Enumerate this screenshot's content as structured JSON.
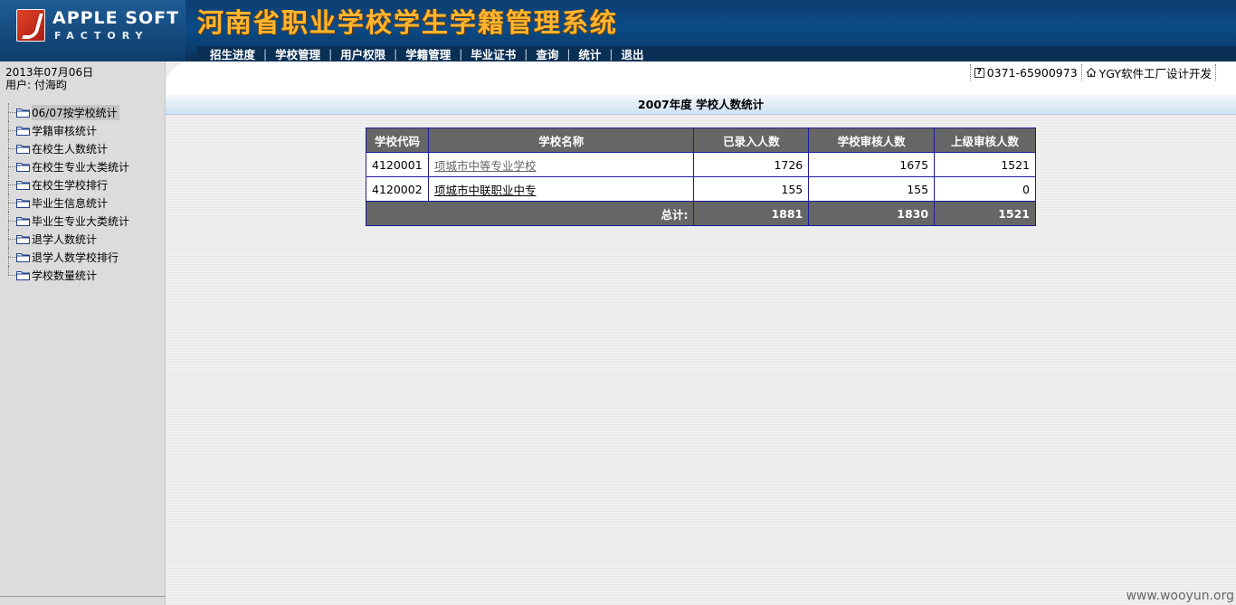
{
  "header": {
    "logo_main": "APPLE SOFT",
    "logo_sub": "FACTORY",
    "system_title": "河南省职业学校学生学籍管理系统",
    "nav": [
      "招生进度",
      "学校管理",
      "用户权限",
      "学籍管理",
      "毕业证书",
      "查询",
      "统计",
      "退出"
    ]
  },
  "sidebar": {
    "date": "2013年07月06日",
    "user": "用户: 付海昀",
    "items": [
      "06/07按学校统计",
      "学籍审核统计",
      "在校生人数统计",
      "在校生专业大类统计",
      "在校生学校排行",
      "毕业生信息统计",
      "毕业生专业大类统计",
      "退学人数统计",
      "退学人数学校排行",
      "学校数量统计"
    ]
  },
  "main": {
    "phone": "0371-65900973",
    "developer": "YGY软件工厂设计开发",
    "page_title": "2007年度 学校人数统计",
    "table": {
      "headers": [
        "学校代码",
        "学校名称",
        "已录入人数",
        "学校审核人数",
        "上级审核人数"
      ],
      "rows": [
        [
          "4120001",
          "项城市中等专业学校",
          "1726",
          "1675",
          "1521"
        ],
        [
          "4120002",
          "项城市中联职业中专",
          "155",
          "155",
          "0"
        ]
      ],
      "total_label": "总计:",
      "totals": [
        "1881",
        "1830",
        "1521"
      ]
    }
  },
  "watermark": "www.wooyun.org",
  "colors": {
    "header_bg": "#0b4b86",
    "title_orange": "#ffb530",
    "table_header_bg": "#666666",
    "table_border": "#1d1d9a"
  }
}
